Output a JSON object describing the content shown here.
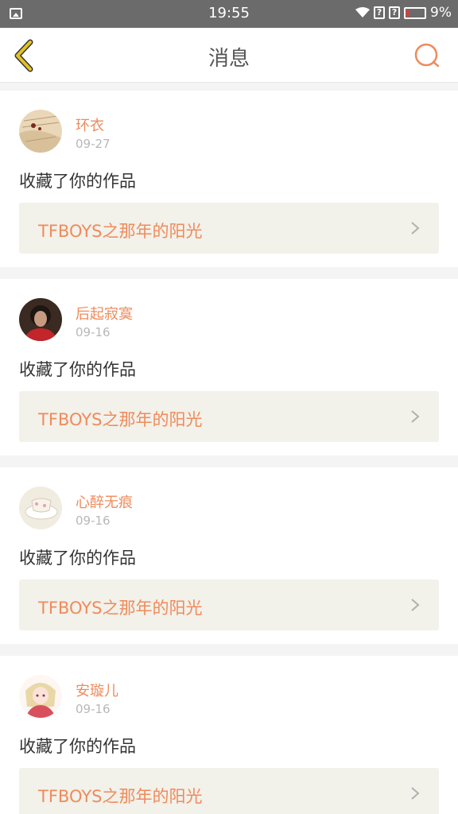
{
  "status_bar": {
    "time": "19:55",
    "battery": "9%"
  },
  "header": {
    "title": "消息"
  },
  "notifications": [
    {
      "user": "环衣",
      "date": "09-27",
      "action": "收藏了你的作品",
      "work_title": "TFBOYS之那年的阳光"
    },
    {
      "user": "后起寂寞",
      "date": "09-16",
      "action": "收藏了你的作品",
      "work_title": "TFBOYS之那年的阳光"
    },
    {
      "user": "心醉无痕",
      "date": "09-16",
      "action": "收藏了你的作品",
      "work_title": "TFBOYS之那年的阳光"
    },
    {
      "user": "安璇儿",
      "date": "09-16",
      "action": "收藏了你的作品",
      "work_title": "TFBOYS之那年的阳光"
    }
  ],
  "colors": {
    "accent": "#ef8b5c",
    "back_icon": "#e2c227",
    "status_bar": "#6b6b6b"
  },
  "icons": {
    "back": "chevron-left-icon",
    "search": "search-icon",
    "item_arrow": "chevron-right-icon"
  }
}
